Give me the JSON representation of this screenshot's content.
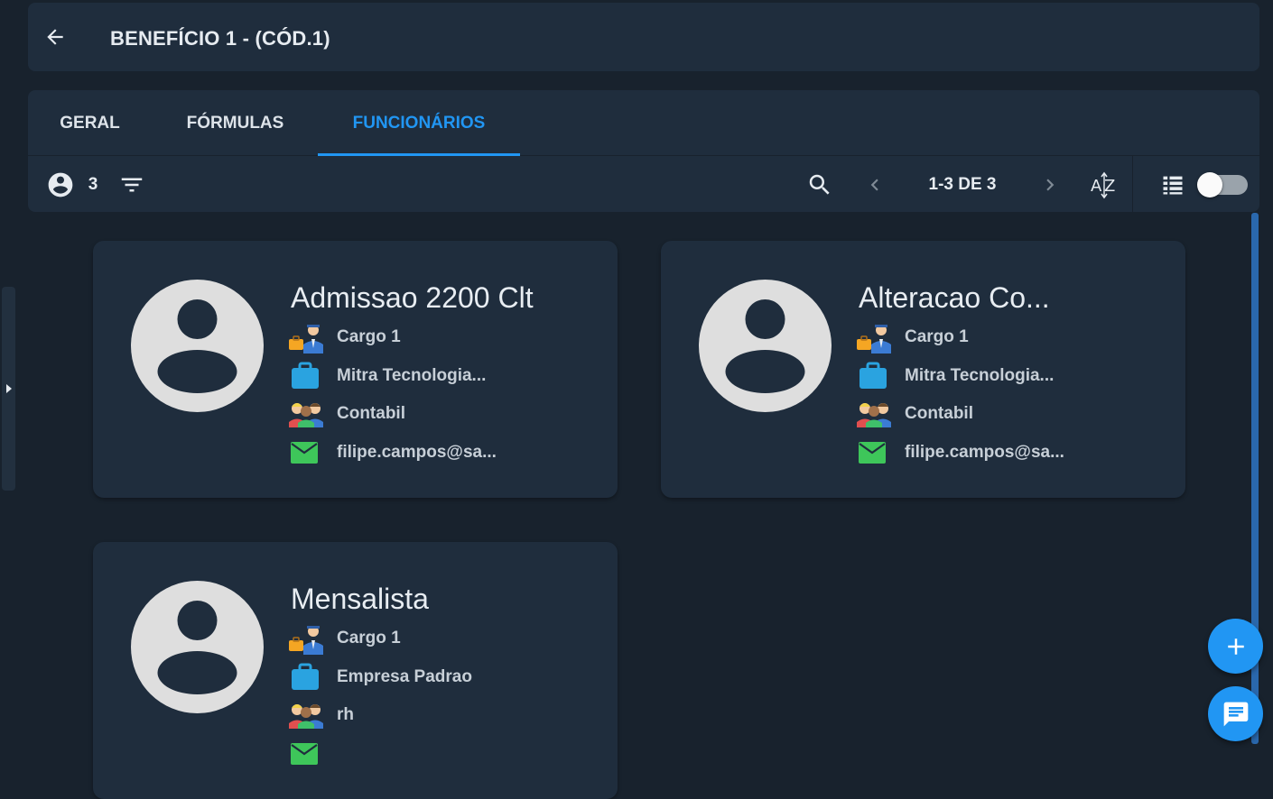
{
  "header": {
    "title": "BENEFÍCIO 1 - (CÓD.1)"
  },
  "tabs": [
    {
      "label": "GERAL"
    },
    {
      "label": "FÓRMULAS"
    },
    {
      "label": "FUNCIONÁRIOS"
    }
  ],
  "active_tab": "FUNCIONÁRIOS",
  "toolbar": {
    "count": "3",
    "pagination": "1-3 DE 3",
    "view_toggle_on": false
  },
  "cards": [
    {
      "name": "Admissao 2200 Clt",
      "cargo": "Cargo 1",
      "empresa": "Mitra Tecnologia...",
      "departamento": "Contabil",
      "email": "filipe.campos@sa..."
    },
    {
      "name": "Alteracao Co...",
      "cargo": "Cargo 1",
      "empresa": "Mitra Tecnologia...",
      "departamento": "Contabil",
      "email": "filipe.campos@sa..."
    },
    {
      "name": "Mensalista",
      "cargo": "Cargo 1",
      "empresa": "Empresa Padrao",
      "departamento": "rh",
      "email": ""
    }
  ],
  "colors": {
    "background": "#18222d",
    "surface": "#1f2d3d",
    "accent": "#2196f3",
    "email_icon": "#3ec65a",
    "briefcase_icon": "#2aa3e0"
  }
}
